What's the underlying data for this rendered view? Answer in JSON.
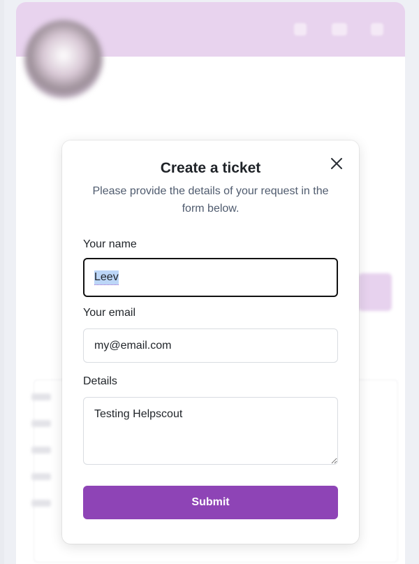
{
  "modal": {
    "title": "Create a ticket",
    "subtitle": "Please provide the details of your request in the form below.",
    "fields": {
      "name": {
        "label": "Your name",
        "value": "Leev"
      },
      "email": {
        "label": "Your email",
        "value": "my@email.com"
      },
      "details": {
        "label": "Details",
        "value": "Testing Helpscout"
      }
    },
    "submit_label": "Submit"
  },
  "icons": {
    "close": "close-icon",
    "resize": "resize-handle-icon"
  },
  "colors": {
    "accent": "#8e44b6",
    "header_bg": "#e8d3ee"
  }
}
